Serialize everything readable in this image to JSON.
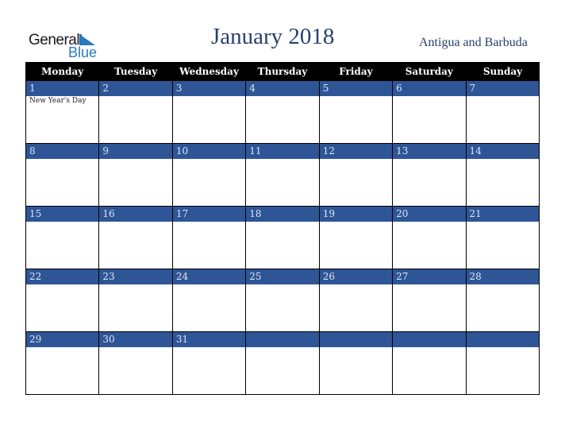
{
  "logo": {
    "line1": "General",
    "line2": "Blue",
    "accent": "#2a7abf"
  },
  "header": {
    "title": "January 2018",
    "country": "Antigua and Barbuda"
  },
  "colors": {
    "header_bg": "#000000",
    "day_bar": "#2e5596",
    "title": "#26416e"
  },
  "weekdays": [
    "Monday",
    "Tuesday",
    "Wednesday",
    "Thursday",
    "Friday",
    "Saturday",
    "Sunday"
  ],
  "weeks": [
    [
      {
        "day": "1",
        "event": "New Year's Day"
      },
      {
        "day": "2",
        "event": ""
      },
      {
        "day": "3",
        "event": ""
      },
      {
        "day": "4",
        "event": ""
      },
      {
        "day": "5",
        "event": ""
      },
      {
        "day": "6",
        "event": ""
      },
      {
        "day": "7",
        "event": ""
      }
    ],
    [
      {
        "day": "8",
        "event": ""
      },
      {
        "day": "9",
        "event": ""
      },
      {
        "day": "10",
        "event": ""
      },
      {
        "day": "11",
        "event": ""
      },
      {
        "day": "12",
        "event": ""
      },
      {
        "day": "13",
        "event": ""
      },
      {
        "day": "14",
        "event": ""
      }
    ],
    [
      {
        "day": "15",
        "event": ""
      },
      {
        "day": "16",
        "event": ""
      },
      {
        "day": "17",
        "event": ""
      },
      {
        "day": "18",
        "event": ""
      },
      {
        "day": "19",
        "event": ""
      },
      {
        "day": "20",
        "event": ""
      },
      {
        "day": "21",
        "event": ""
      }
    ],
    [
      {
        "day": "22",
        "event": ""
      },
      {
        "day": "23",
        "event": ""
      },
      {
        "day": "24",
        "event": ""
      },
      {
        "day": "25",
        "event": ""
      },
      {
        "day": "26",
        "event": ""
      },
      {
        "day": "27",
        "event": ""
      },
      {
        "day": "28",
        "event": ""
      }
    ],
    [
      {
        "day": "29",
        "event": ""
      },
      {
        "day": "30",
        "event": ""
      },
      {
        "day": "31",
        "event": ""
      },
      {
        "day": "",
        "event": ""
      },
      {
        "day": "",
        "event": ""
      },
      {
        "day": "",
        "event": ""
      },
      {
        "day": "",
        "event": ""
      }
    ]
  ]
}
